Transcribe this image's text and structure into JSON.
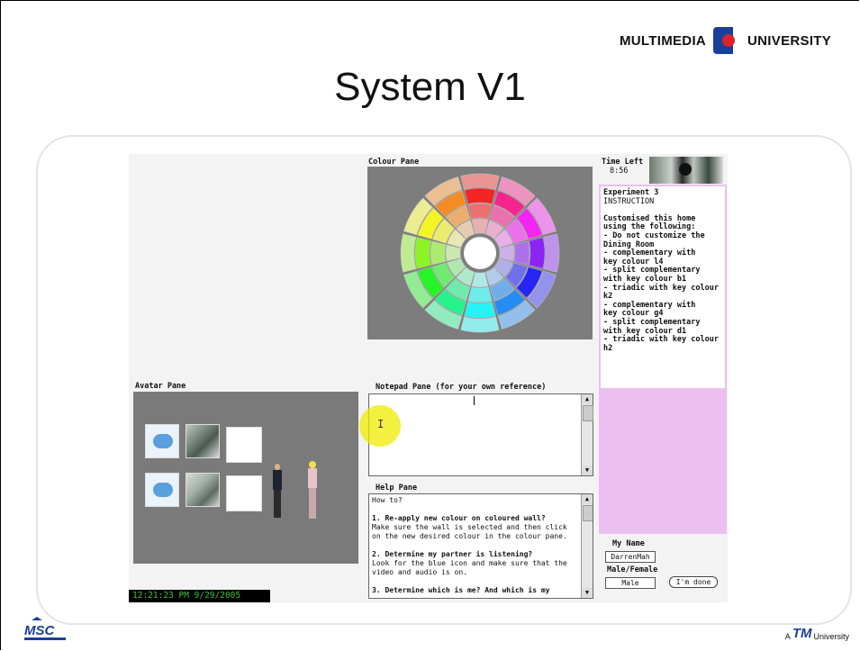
{
  "slide": {
    "title": "System V1",
    "university_logo_left": "MULTIMEDIA",
    "university_logo_right": "UNIVERSITY",
    "footer_right_prefix": "A",
    "footer_right_brand": "TM",
    "footer_right_suffix": "University",
    "footer_left_logo": "MSC"
  },
  "app": {
    "colour_pane_label": "Colour Pane",
    "avatar_pane_label": "Avatar Pane",
    "notepad_label": "Notepad Pane (for your own reference)",
    "help_label": "Help Pane",
    "time_left_label": "Time Left",
    "time_left_value": "8:56",
    "clock": "12:21:23 PM 9/29/2005",
    "help_lines": [
      {
        "text": "How to?",
        "bold": false
      },
      {
        "text": "",
        "bold": false
      },
      {
        "text": "1. Re-apply new colour on coloured wall?",
        "bold": true
      },
      {
        "text": "Make sure the wall is selected and then click on the new desired colour in the colour pane.",
        "bold": false
      },
      {
        "text": "",
        "bold": false
      },
      {
        "text": "2. Determine my partner is listening?",
        "bold": true
      },
      {
        "text": "Look for the blue icon and make sure that the video and audio is on.",
        "bold": false
      },
      {
        "text": "",
        "bold": false
      },
      {
        "text": "3. Determine which is me? And which is my",
        "bold": true
      }
    ],
    "instructions": [
      "Experiment 3",
      "INSTRUCTION",
      "",
      "Customised this home",
      "using the following:",
      "- Do not customize the",
      "Dining Room",
      "- complementary with",
      "key colour l4",
      "- split complementary",
      "with key colour b1",
      "- triadic with key colour",
      "k2",
      "- complementary with",
      "key colour g4",
      "- split complementary",
      "with key colour d1",
      "- triadic with key colour",
      "h2"
    ],
    "my_name_label": "My Name",
    "my_name_value": "DarrenMah",
    "gender_label": "Male/Female",
    "gender_value": "Male",
    "done_button": "I'm done"
  },
  "colors": {
    "pink_panel": "#ecbff0",
    "pane_gray": "#7d7d7d",
    "clock_text": "#3fc13f"
  }
}
